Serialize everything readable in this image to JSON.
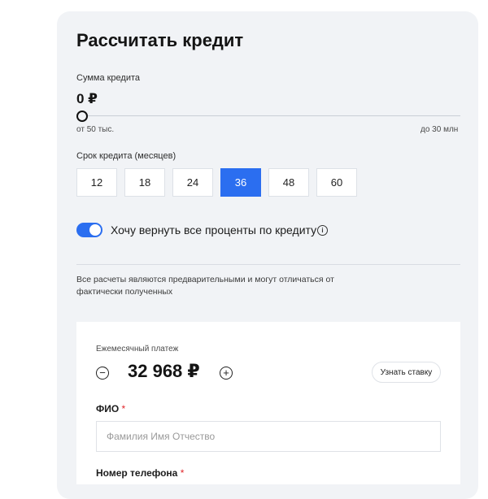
{
  "calculator": {
    "title": "Рассчитать кредит",
    "amount_label": "Сумма кредита",
    "amount_value": "0 ₽",
    "slider_level": 0,
    "range_min": "от 50 тыс.",
    "range_max": "до 30 млн",
    "term_label": "Срок кредита (месяцев)",
    "terms": [
      "12",
      "18",
      "24",
      "36",
      "48",
      "60"
    ],
    "term_selected": "36",
    "toggle_label": "Хочу вернуть все проценты по кредиту",
    "toggle_on": true,
    "info_glyph": "i",
    "disclaimer": "Все расчеты являются предварительными и могут отличаться от фактически полученных"
  },
  "payment": {
    "label": "Ежемесячный платеж",
    "minus_glyph": "−",
    "value": "32 968 ₽",
    "plus_glyph": "+",
    "rate_button": "Узнать ставку"
  },
  "form": {
    "name_label": "ФИО",
    "name_placeholder": "Фамилия Имя Отчество",
    "phone_label": "Номер телефона",
    "required_mark": "*"
  },
  "colors": {
    "accent": "#2b6ef0",
    "card_bg": "#f1f3f6",
    "required": "#e1262b"
  },
  "icons": [
    "info-icon",
    "minus-icon",
    "plus-icon"
  ]
}
